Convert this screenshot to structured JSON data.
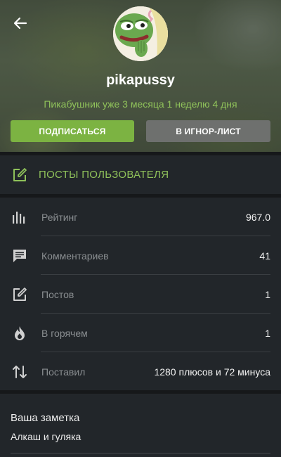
{
  "profile": {
    "username": "pikapussy",
    "since_text": "Пикабушник уже 3 месяца 1 неделю 4 дня",
    "subscribe_label": "ПОДПИСАТЬСЯ",
    "ignore_label": "В ИГНОР-ЛИСТ"
  },
  "posts_link": {
    "label": "ПОСТЫ ПОЛЬЗОВАТЕЛЯ"
  },
  "stats": [
    {
      "icon": "rating-bars-icon",
      "label": "Рейтинг",
      "value": "967.0"
    },
    {
      "icon": "comments-icon",
      "label": "Комментариев",
      "value": "41"
    },
    {
      "icon": "edit-post-icon",
      "label": "Постов",
      "value": "1"
    },
    {
      "icon": "flame-icon",
      "label": "В горячем",
      "value": "1"
    },
    {
      "icon": "up-down-arrows-icon",
      "label": "Поставил",
      "value": "1280 плюсов и 72 минуса"
    }
  ],
  "note": {
    "title": "Ваша заметка",
    "text": "Алкаш и гуляка"
  },
  "colors": {
    "accent_green": "#7cb342",
    "link_green": "#8fc15a",
    "panel": "#22262a",
    "background": "#16181a",
    "ignore_button": "#6e706e"
  }
}
